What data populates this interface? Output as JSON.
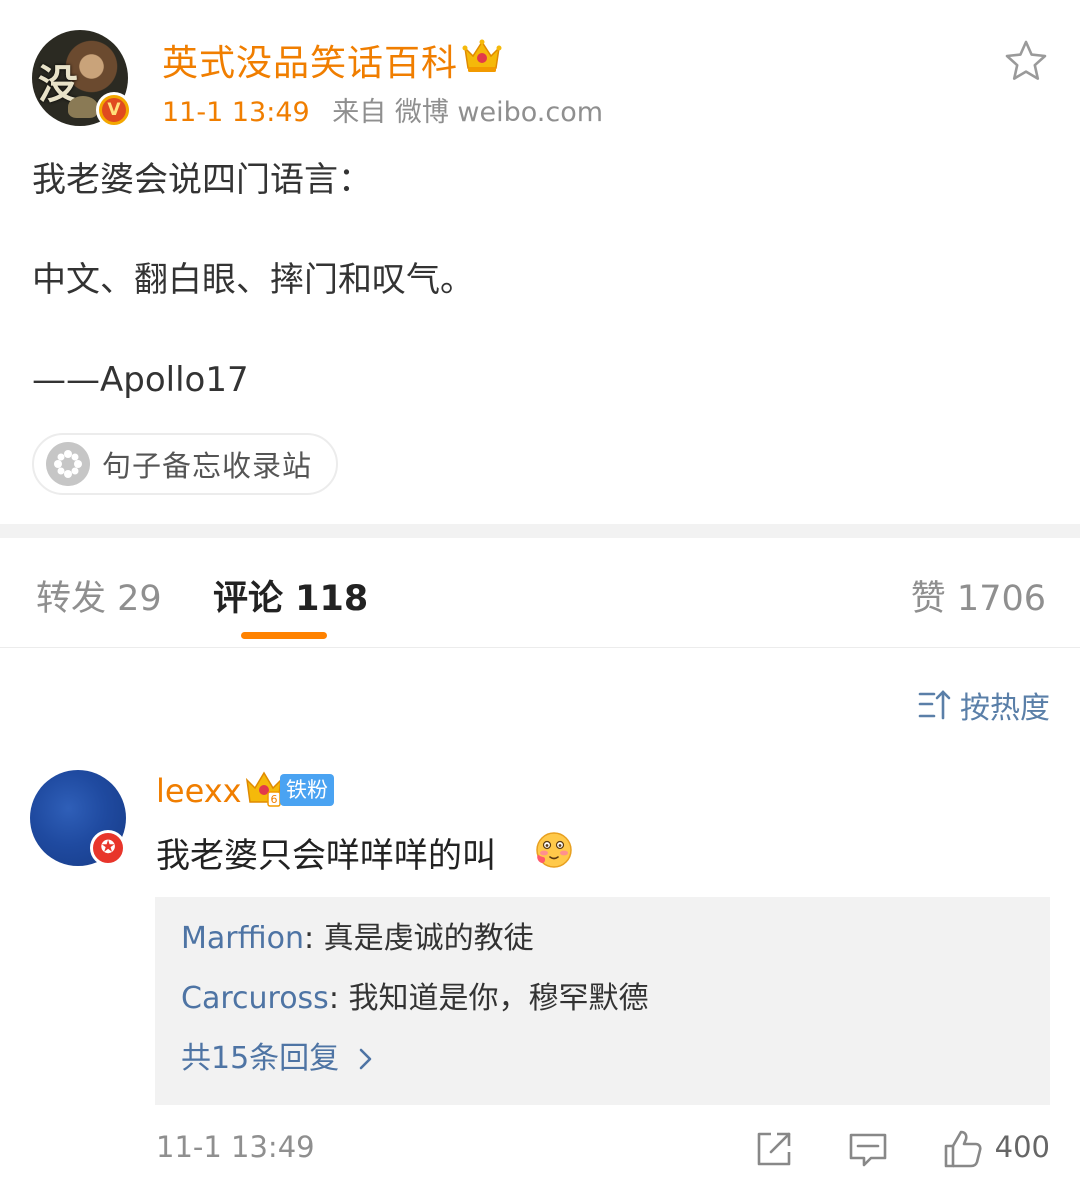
{
  "post": {
    "author": "英式没品笑话百科",
    "time": "11-1 13:49",
    "source": "来自 微博 weibo.com",
    "lines": [
      "我老婆会说四门语言：",
      "中文、翻白眼、摔门和叹气。",
      "——Apollo17"
    ],
    "avatar_glyph": "没",
    "verify_mark": "V",
    "topic": "句子备忘收录站"
  },
  "tabs": {
    "repost": "转发 29",
    "comment": "评论 118",
    "like": "赞 1706"
  },
  "sort_label": "按热度",
  "comment": {
    "author": "leexx",
    "fan_tag": "铁粉",
    "text": "我老婆只会咩咩咩的叫",
    "replies": [
      {
        "author": "Marffion",
        "text": ": 真是虔诚的教徒"
      },
      {
        "author": "Carcuross",
        "text": ": 我知道是你，穆罕默德"
      }
    ],
    "more_replies": "共15条回复",
    "time": "11-1 13:49",
    "likes": "400"
  },
  "colors": {
    "accent_orange": "#f07e00",
    "tab_underline": "#ff8200",
    "link_blue": "#4e74a4",
    "fan_tag_blue": "#4aa3f2"
  },
  "icons": [
    "crown-icon",
    "star-icon",
    "topic-icon",
    "sort-icon",
    "fan-crown-icon",
    "blush-icon",
    "chevron-right-icon",
    "share-icon",
    "reply-icon",
    "like-icon"
  ]
}
